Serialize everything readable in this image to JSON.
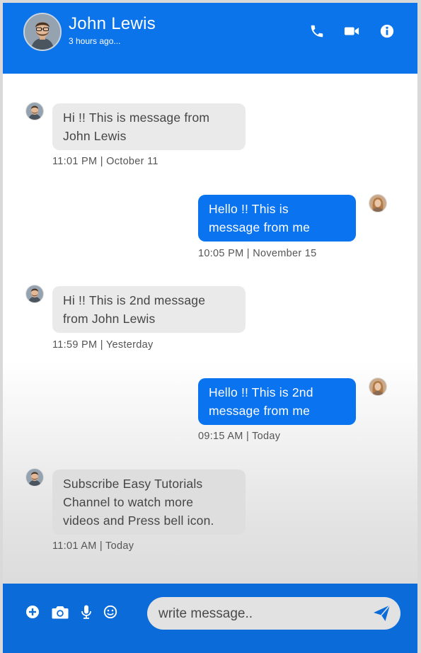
{
  "header": {
    "name": "John Lewis",
    "status": "3 hours ago..."
  },
  "messages": [
    {
      "direction": "incoming",
      "text": "Hi !! This is message from John Lewis",
      "lines": [
        "Hi !! This is message from",
        "John Lewis"
      ],
      "time": "11:01 PM | October 11"
    },
    {
      "direction": "outgoing",
      "text": "Hello !! This is message from me",
      "lines": [
        "Hello !! This is",
        "message from me"
      ],
      "time": "10:05 PM | November 15"
    },
    {
      "direction": "incoming",
      "text": "Hi !! This is 2nd message from John Lewis",
      "lines": [
        "Hi !! This is 2nd message",
        "from John Lewis"
      ],
      "time": "11:59 PM | Yesterday"
    },
    {
      "direction": "outgoing",
      "text": "Hello !! This is 2nd message from me",
      "lines": [
        "Hello !! This is 2nd",
        "message from me"
      ],
      "time": "09:15 AM | Today"
    },
    {
      "direction": "incoming",
      "text": "Subscribe Easy Tutorials Channel to watch more videos and Press bell icon.",
      "lines": [
        "Subscribe Easy Tutorials",
        "Channel to watch more",
        "videos and Press bell icon."
      ],
      "time": "11:01 AM | Today"
    }
  ],
  "composer": {
    "placeholder": "write message.."
  },
  "colors": {
    "header_bg": "#0b74ea",
    "footer_bg": "#0b6cd9",
    "outgoing_bubble": "#0a73f0",
    "incoming_bubble": "#eaeaea"
  },
  "icons": {
    "header": [
      "phone-icon",
      "video-camera-icon",
      "info-icon"
    ],
    "footer": [
      "plus-circle-icon",
      "camera-icon",
      "microphone-icon",
      "smile-icon",
      "send-icon"
    ]
  }
}
